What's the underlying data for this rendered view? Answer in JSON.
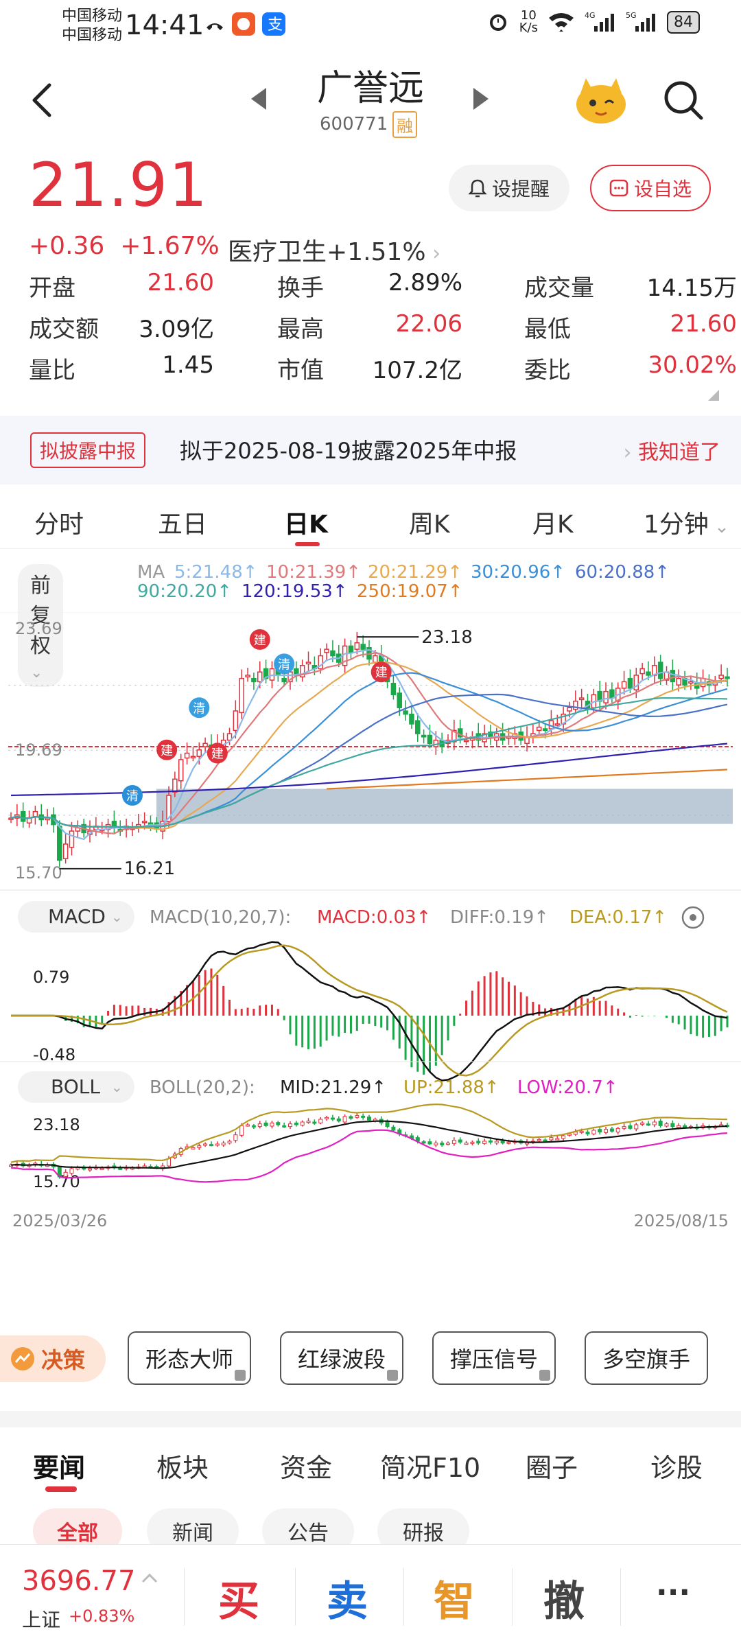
{
  "status": {
    "carrier1": "中国移动",
    "carrier2": "中国移动",
    "time": "14:41",
    "speed_top": "10",
    "speed_bot": "K/s",
    "battery": "84",
    "net1": "4G",
    "net2": "5G"
  },
  "header": {
    "name": "广誉远",
    "code": "600771",
    "margin_tag": "融"
  },
  "quote": {
    "price": "21.91",
    "change": "+0.36",
    "pct": "+1.67%",
    "sector": "医疗卫生+1.51%",
    "alert_label": "设提醒",
    "watch_label": "设自选"
  },
  "stats": [
    {
      "label": "开盘",
      "value": "21.60",
      "red": true
    },
    {
      "label": "换手",
      "value": "2.89%",
      "red": false
    },
    {
      "label": "成交量",
      "value": "14.15万",
      "red": false
    },
    {
      "label": "成交额",
      "value": "3.09亿",
      "red": false
    },
    {
      "label": "最高",
      "value": "22.06",
      "red": true
    },
    {
      "label": "最低",
      "value": "21.60",
      "red": true
    },
    {
      "label": "量比",
      "value": "1.45",
      "red": false
    },
    {
      "label": "市值",
      "value": "107.2亿",
      "red": false
    },
    {
      "label": "委比",
      "value": "30.02%",
      "red": true
    }
  ],
  "banner": {
    "tag": "拟披露中报",
    "text": "拟于2025-08-19披露2025年中报",
    "action": "我知道了"
  },
  "ktabs": [
    "分时",
    "五日",
    "日K",
    "周K",
    "月K",
    "1分钟"
  ],
  "chart": {
    "adjust": "前复权",
    "ma_title": "MA",
    "ma": [
      {
        "label": "5:21.48↑",
        "color": "#8ab8e8"
      },
      {
        "label": "10:21.39↑",
        "color": "#e07a7a"
      },
      {
        "label": "20:21.29↑",
        "color": "#e8a850"
      },
      {
        "label": "30:20.96↑",
        "color": "#3a8fd8"
      },
      {
        "label": "60:20.88↑",
        "color": "#4a70c8"
      },
      {
        "label": "90:20.20↑",
        "color": "#40a8a0"
      },
      {
        "label": "120:19.53↑",
        "color": "#3020b0"
      },
      {
        "label": "250:19.07↑",
        "color": "#e07a20"
      }
    ],
    "y_top": "23.69",
    "y_mid": "19.69",
    "y_bottom": "15.70",
    "high_label": "23.18",
    "low_label": "16.21",
    "markers": [
      "清",
      "建",
      "清",
      "建",
      "清",
      "建",
      "建"
    ],
    "macd_sel": "MACD",
    "macd_param": "MACD(10,20,7):",
    "macd_val": "MACD:0.03↑",
    "diff_val": "DIFF:0.19↑",
    "dea_val": "DEA:0.17↑",
    "macd_top": "0.79",
    "macd_bottom": "-0.48",
    "boll_sel": "BOLL",
    "boll_param": "BOLL(20,2):",
    "mid_val": "MID:21.29↑",
    "up_val": "UP:21.88↑",
    "low_val": "LOW:20.7↑",
    "boll_top": "23.18",
    "boll_bottom": "15.70",
    "date_start": "2025/03/26",
    "date_end": "2025/08/15",
    "colors": {
      "up": "#e0323d",
      "down": "#1aa84a",
      "diff": "#111111",
      "dea": "#b89a20",
      "boll_mid": "#111111",
      "boll_up": "#b89a20",
      "boll_low": "#e020c0"
    }
  },
  "tools": {
    "decide": "决策",
    "items": [
      "形态大师",
      "红绿波段",
      "撑压信号",
      "多空旗手"
    ]
  },
  "news_tabs": [
    "要闻",
    "板块",
    "资金",
    "简况F10",
    "圈子",
    "诊股"
  ],
  "news_chips": [
    "全部",
    "新闻",
    "公告",
    "研报"
  ],
  "bottom": {
    "index_value": "3696.77",
    "index_name": "上证",
    "index_change": "+0.83%",
    "buy": "买",
    "sell": "卖",
    "smart": "智",
    "cancel": "撤",
    "more": "···"
  }
}
